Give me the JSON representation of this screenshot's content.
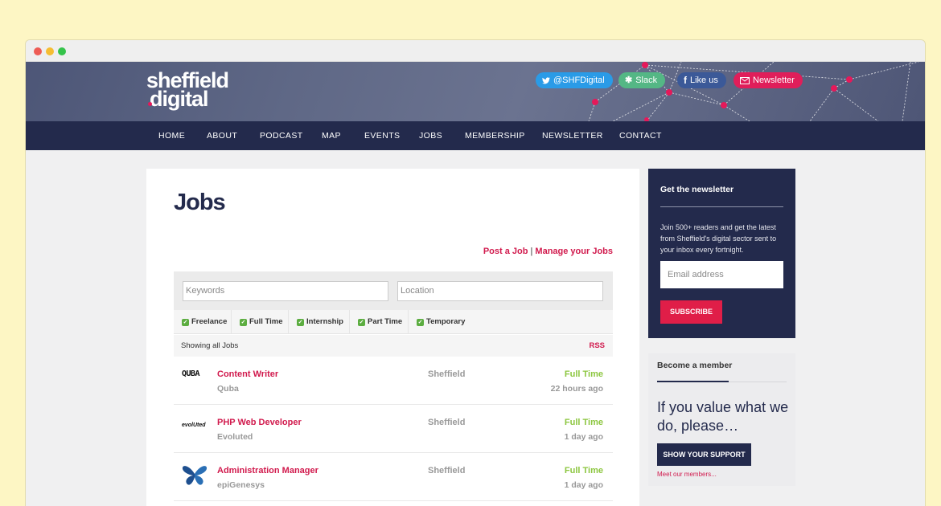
{
  "site": {
    "logo_line1": "sheffield",
    "logo_line2": "digital",
    "social": {
      "twitter": "@SHFDigital",
      "slack": "Slack",
      "facebook": "Like us",
      "newsletter": "Newsletter"
    },
    "nav": [
      "HOME",
      "ABOUT",
      "PODCAST",
      "MAP",
      "EVENTS",
      "JOBS",
      "MEMBERSHIP",
      "NEWSLETTER",
      "CONTACT"
    ]
  },
  "jobs_page": {
    "title": "Jobs",
    "post_job": "Post a Job",
    "separator": "|",
    "manage_jobs": "Manage your Jobs",
    "keywords_placeholder": "Keywords",
    "location_placeholder": "Location",
    "job_types": [
      "Freelance",
      "Full Time",
      "Internship",
      "Part Time",
      "Temporary"
    ],
    "showing_text": "Showing all Jobs",
    "rss": "RSS",
    "listings": [
      {
        "logo_text": "QUBA",
        "title": "Content Writer",
        "company": "Quba",
        "location": "Sheffield",
        "type": "Full Time",
        "posted": "22 hours ago"
      },
      {
        "logo_text": "evolUted",
        "title": "PHP Web Developer",
        "company": "Evoluted",
        "location": "Sheffield",
        "type": "Full Time",
        "posted": "1 day ago"
      },
      {
        "logo_text": "",
        "title": "Administration Manager",
        "company": "epiGenesys",
        "location": "Sheffield",
        "type": "Full Time",
        "posted": "1 day ago"
      }
    ]
  },
  "sidebar": {
    "newsletter": {
      "title": "Get the newsletter",
      "text": "Join 500+ readers and get the latest from Sheffield's digital sector sent to your inbox every fortnight.",
      "email_placeholder": "Email address",
      "button": "SUBSCRIBE"
    },
    "member": {
      "title": "Become a member",
      "tagline": "If you value what we do, please…",
      "button": "SHOW YOUR SUPPORT",
      "link": "Meet our members..."
    }
  },
  "colors": {
    "navy": "#232a4c",
    "pink": "#e01e5a",
    "green": "#8cc63f"
  }
}
